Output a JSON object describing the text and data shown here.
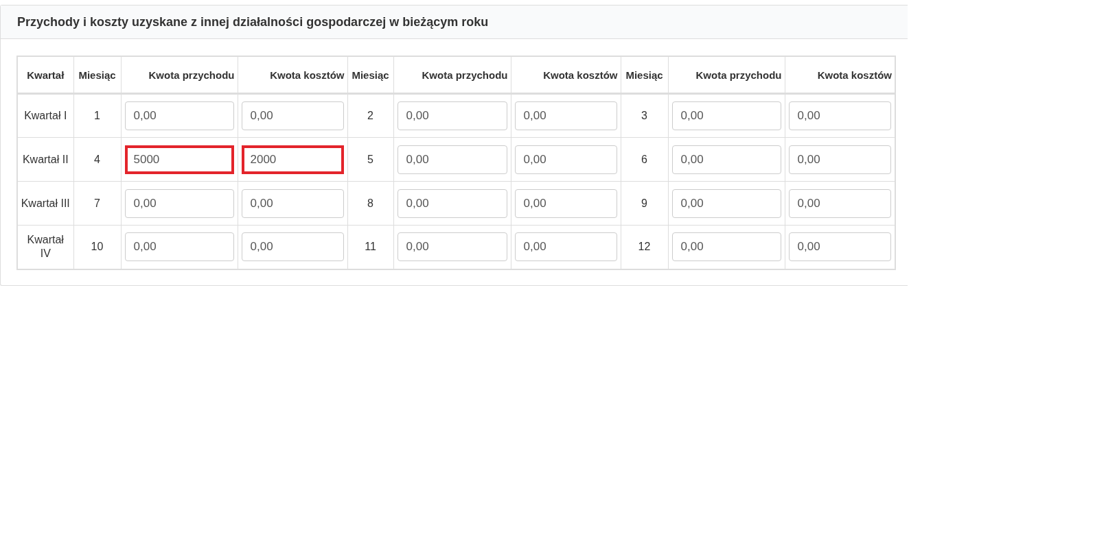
{
  "panel": {
    "title": "Przychody i koszty uzyskane z innej działalności gospodarczej w bieżącym roku"
  },
  "table": {
    "columns": [
      "Kwartał",
      "Miesiąc",
      "Kwota przychodu",
      "Kwota kosztów",
      "Miesiąc",
      "Kwota przychodu",
      "Kwota kosztów",
      "Miesiąc",
      "Kwota przychodu",
      "Kwota kosztów"
    ],
    "rows": [
      {
        "quarter": "Kwartał I",
        "months": [
          {
            "month": "1",
            "revenue": {
              "value": "0,00",
              "highlighted": false
            },
            "costs": {
              "value": "0,00",
              "highlighted": false
            }
          },
          {
            "month": "2",
            "revenue": {
              "value": "0,00",
              "highlighted": false
            },
            "costs": {
              "value": "0,00",
              "highlighted": false
            }
          },
          {
            "month": "3",
            "revenue": {
              "value": "0,00",
              "highlighted": false
            },
            "costs": {
              "value": "0,00",
              "highlighted": false
            }
          }
        ]
      },
      {
        "quarter": "Kwartał II",
        "months": [
          {
            "month": "4",
            "revenue": {
              "value": "5000",
              "highlighted": true
            },
            "costs": {
              "value": "2000",
              "highlighted": true
            }
          },
          {
            "month": "5",
            "revenue": {
              "value": "0,00",
              "highlighted": false
            },
            "costs": {
              "value": "0,00",
              "highlighted": false
            }
          },
          {
            "month": "6",
            "revenue": {
              "value": "0,00",
              "highlighted": false
            },
            "costs": {
              "value": "0,00",
              "highlighted": false
            }
          }
        ]
      },
      {
        "quarter": "Kwartał III",
        "months": [
          {
            "month": "7",
            "revenue": {
              "value": "0,00",
              "highlighted": false
            },
            "costs": {
              "value": "0,00",
              "highlighted": false
            }
          },
          {
            "month": "8",
            "revenue": {
              "value": "0,00",
              "highlighted": false
            },
            "costs": {
              "value": "0,00",
              "highlighted": false
            }
          },
          {
            "month": "9",
            "revenue": {
              "value": "0,00",
              "highlighted": false
            },
            "costs": {
              "value": "0,00",
              "highlighted": false
            }
          }
        ]
      },
      {
        "quarter": "Kwartał IV",
        "months": [
          {
            "month": "10",
            "revenue": {
              "value": "0,00",
              "highlighted": false
            },
            "costs": {
              "value": "0,00",
              "highlighted": false
            }
          },
          {
            "month": "11",
            "revenue": {
              "value": "0,00",
              "highlighted": false
            },
            "costs": {
              "value": "0,00",
              "highlighted": false
            }
          },
          {
            "month": "12",
            "revenue": {
              "value": "0,00",
              "highlighted": false
            },
            "costs": {
              "value": "0,00",
              "highlighted": false
            }
          }
        ]
      }
    ]
  }
}
